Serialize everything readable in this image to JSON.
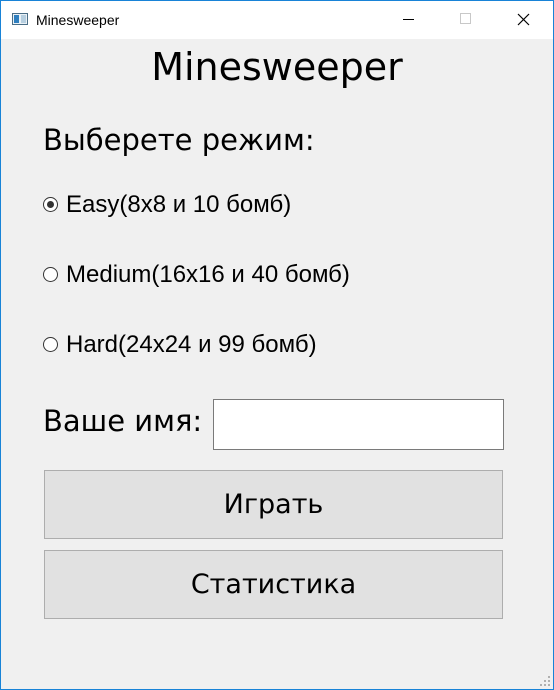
{
  "window": {
    "title": "Minesweeper",
    "icons": {
      "app": "minesweeper-app-icon",
      "minimize": "minimize-icon",
      "maximize": "maximize-icon",
      "close": "close-icon"
    }
  },
  "main": {
    "heading": "Minesweeper",
    "mode_prompt": "Выберете режим:",
    "modes": [
      {
        "label": "Easy(8x8 и 10 бомб)",
        "selected": true
      },
      {
        "label": "Medium(16x16 и 40 бомб)",
        "selected": false
      },
      {
        "label": "Hard(24x24 и 99 бомб)",
        "selected": false
      }
    ],
    "name_label": "Ваше имя:",
    "name_value": "",
    "play_button": "Играть",
    "stats_button": "Статистика"
  },
  "colors": {
    "window_bg": "#f0f0f0",
    "titlebar_bg": "#ffffff",
    "window_border": "#1883d7",
    "button_bg": "#e1e1e1",
    "button_border": "#adadad"
  }
}
